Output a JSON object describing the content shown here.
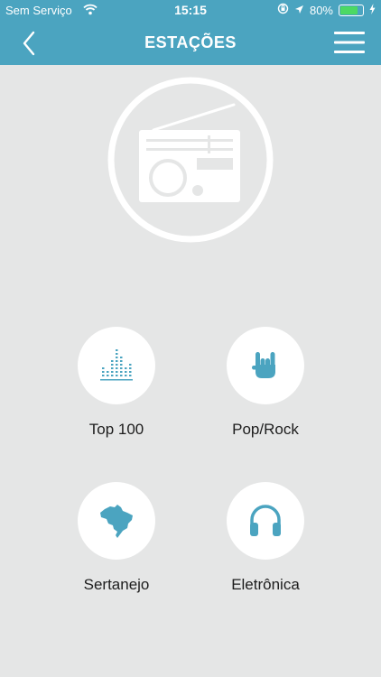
{
  "status_bar": {
    "carrier": "Sem Serviço",
    "time": "15:15",
    "battery": "80%",
    "battery_level": 0.8
  },
  "header": {
    "title": "ESTAÇÕES"
  },
  "colors": {
    "header_bg": "#4ba4c0",
    "accent": "#4ba4c0",
    "background": "#e5e6e6"
  },
  "categories": [
    {
      "label": "Top 100",
      "icon": "equalizer-icon"
    },
    {
      "label": "Pop/Rock",
      "icon": "rock-hand-icon"
    },
    {
      "label": "Sertanejo",
      "icon": "brazil-map-icon"
    },
    {
      "label": "Eletrônica",
      "icon": "headphones-icon"
    }
  ]
}
